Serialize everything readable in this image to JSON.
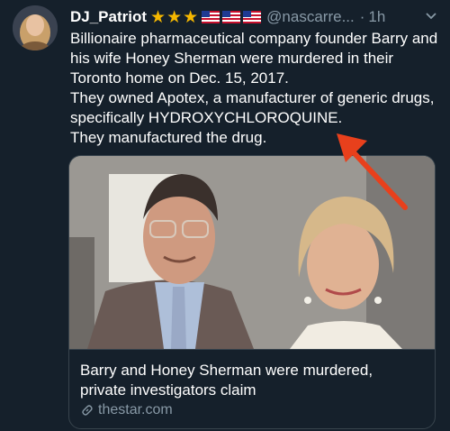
{
  "tweet": {
    "display_name": "DJ_Patriot",
    "handle": "@nascarre...",
    "separator": "·",
    "time": "1h",
    "star_glyph": "★",
    "body_lines": [
      "Billionaire pharmaceutical company founder Barry and his wife Honey Sherman were murdered in their Toronto home on Dec. 15, 2017.",
      "They owned Apotex, a manufacturer of generic drugs, specifically HYDROXYCHLOROQUINE.",
      "They manufactured the drug."
    ]
  },
  "card": {
    "title": "Barry and Honey Sherman were murdered, private investigators claim",
    "domain": "thestar.com"
  },
  "colors": {
    "background": "#15202b",
    "secondary_text": "#8899a6",
    "star": "#f5b700",
    "annotation_arrow": "#e8401c"
  },
  "icons": [
    "avatar",
    "star-icon",
    "us-flag-icon",
    "chevron-down-icon",
    "link-icon",
    "red-arrow-annotation"
  ]
}
